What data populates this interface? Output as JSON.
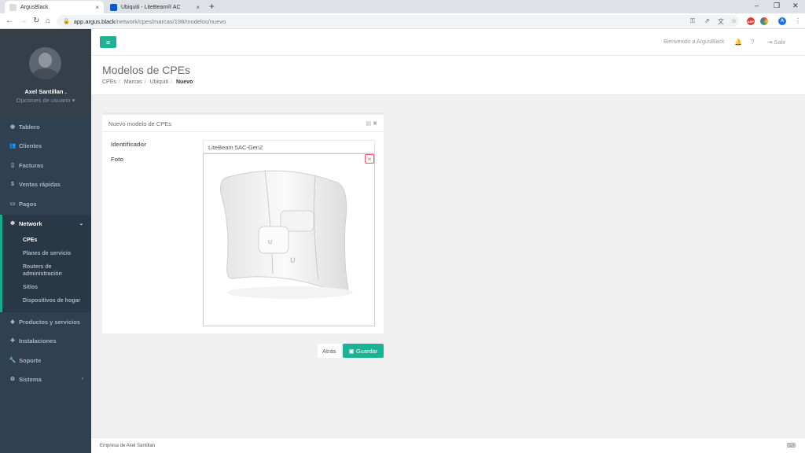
{
  "browser": {
    "tabs": [
      {
        "title": "ArgusBlack",
        "close": "×"
      },
      {
        "title": "Ubiquiti - LiteBeam® AC",
        "close": "×"
      }
    ],
    "new_tab": "+",
    "url_host": "app.argus.black",
    "url_path": "/network/cpes/marcas/198/modelos/nuevo",
    "profile_initial": "A",
    "window": {
      "minimize": "–",
      "restore": "❐",
      "close": "✕"
    }
  },
  "sidebar": {
    "user_name": "Axel Santillan .",
    "user_options": "Opciones de usuario",
    "items": [
      {
        "label": "Tablero"
      },
      {
        "label": "Clientes"
      },
      {
        "label": "Facturas"
      },
      {
        "label": "Ventas rápidas"
      },
      {
        "label": "Pagos"
      },
      {
        "label": "Network"
      },
      {
        "label": "Productos y servicios"
      },
      {
        "label": "Instalaciones"
      },
      {
        "label": "Soporte"
      },
      {
        "label": "Sistema"
      }
    ],
    "network_sub": [
      {
        "label": "CPEs"
      },
      {
        "label": "Planes de servicio"
      },
      {
        "label": "Routers de administración"
      },
      {
        "label": "Sitios"
      },
      {
        "label": "Dispositivos de hogar"
      }
    ]
  },
  "topnav": {
    "welcome": "Bienvenido a ArgusBlack",
    "logout": "Salir"
  },
  "page": {
    "title": "Modelos de CPEs",
    "breadcrumb": [
      "CPEs",
      "Marcas",
      "Ubiquiti",
      "Nuevo"
    ]
  },
  "form": {
    "panel_title": "Nuevo modelo de CPEs",
    "identifier_label": "Identificador",
    "identifier_value": "LiteBeam 5AC-Gen2",
    "photo_label": "Foto",
    "remove_icon": "×",
    "back_label": "Atrás",
    "save_label": "Guardar"
  },
  "footer": {
    "text": "Empresa de Axel Santillan"
  },
  "colors": {
    "accent": "#1ab394",
    "sidebar": "#2f4050",
    "danger": "#ed5565"
  }
}
